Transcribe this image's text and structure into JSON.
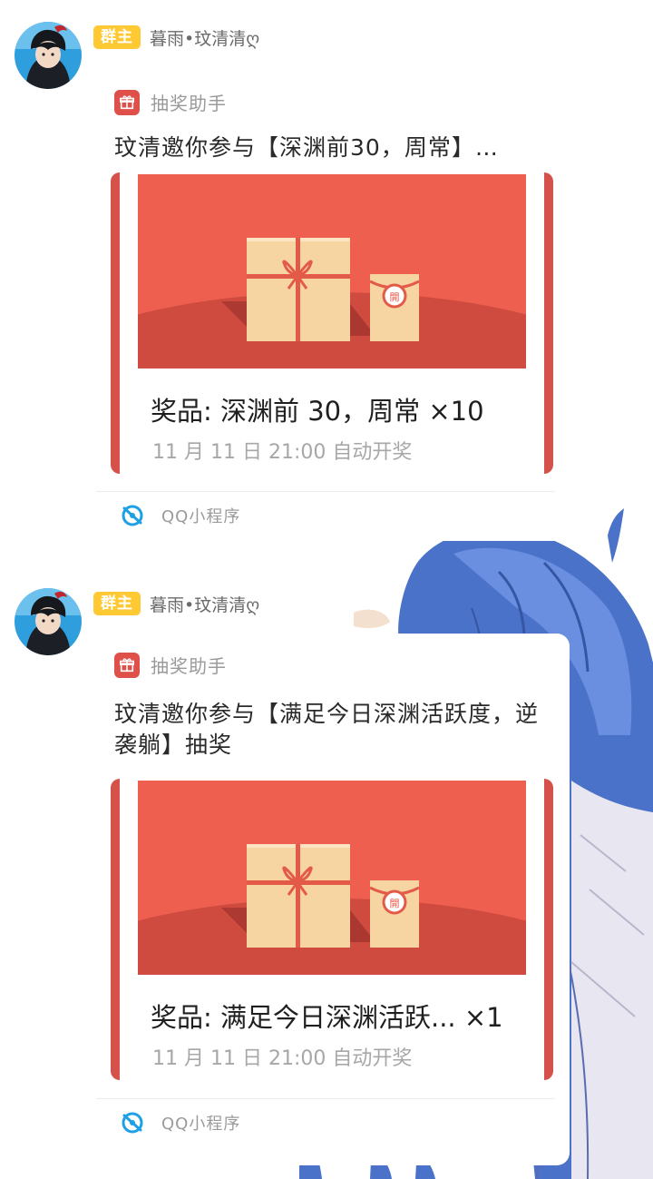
{
  "messages": [
    {
      "badge": "群主",
      "sender": "暮雨•玟清清ღ",
      "app_name": "抽奖助手",
      "invite_text": "玟清邀你参与【深渊前30，周常】…",
      "prize": "奖品: 深渊前 30，周常 ×10",
      "draw_time": "11 月 11 日 21:00 自动开奖",
      "footer": "QQ小程序"
    },
    {
      "badge": "群主",
      "sender": "暮雨•玟清清ღ",
      "app_name": "抽奖助手",
      "invite_text": "玟清邀你参与【满足今日深渊活跃度，逆袭躺】抽奖",
      "prize": "奖品: 满足今日深渊活跃... ×1",
      "draw_time": "11 月 11 日 21:00 自动开奖",
      "footer": "QQ小程序"
    }
  ],
  "colors": {
    "badge": "#ffc933",
    "card_accent": "#d4524a",
    "banner": "#ee5f4f",
    "gift_box": "#f7d5a2",
    "qq_blue": "#1ea0e6"
  },
  "icons": {
    "gift": "gift-icon",
    "miniprogram": "qq-miniprogram-icon",
    "seal": "open-seal-icon"
  }
}
